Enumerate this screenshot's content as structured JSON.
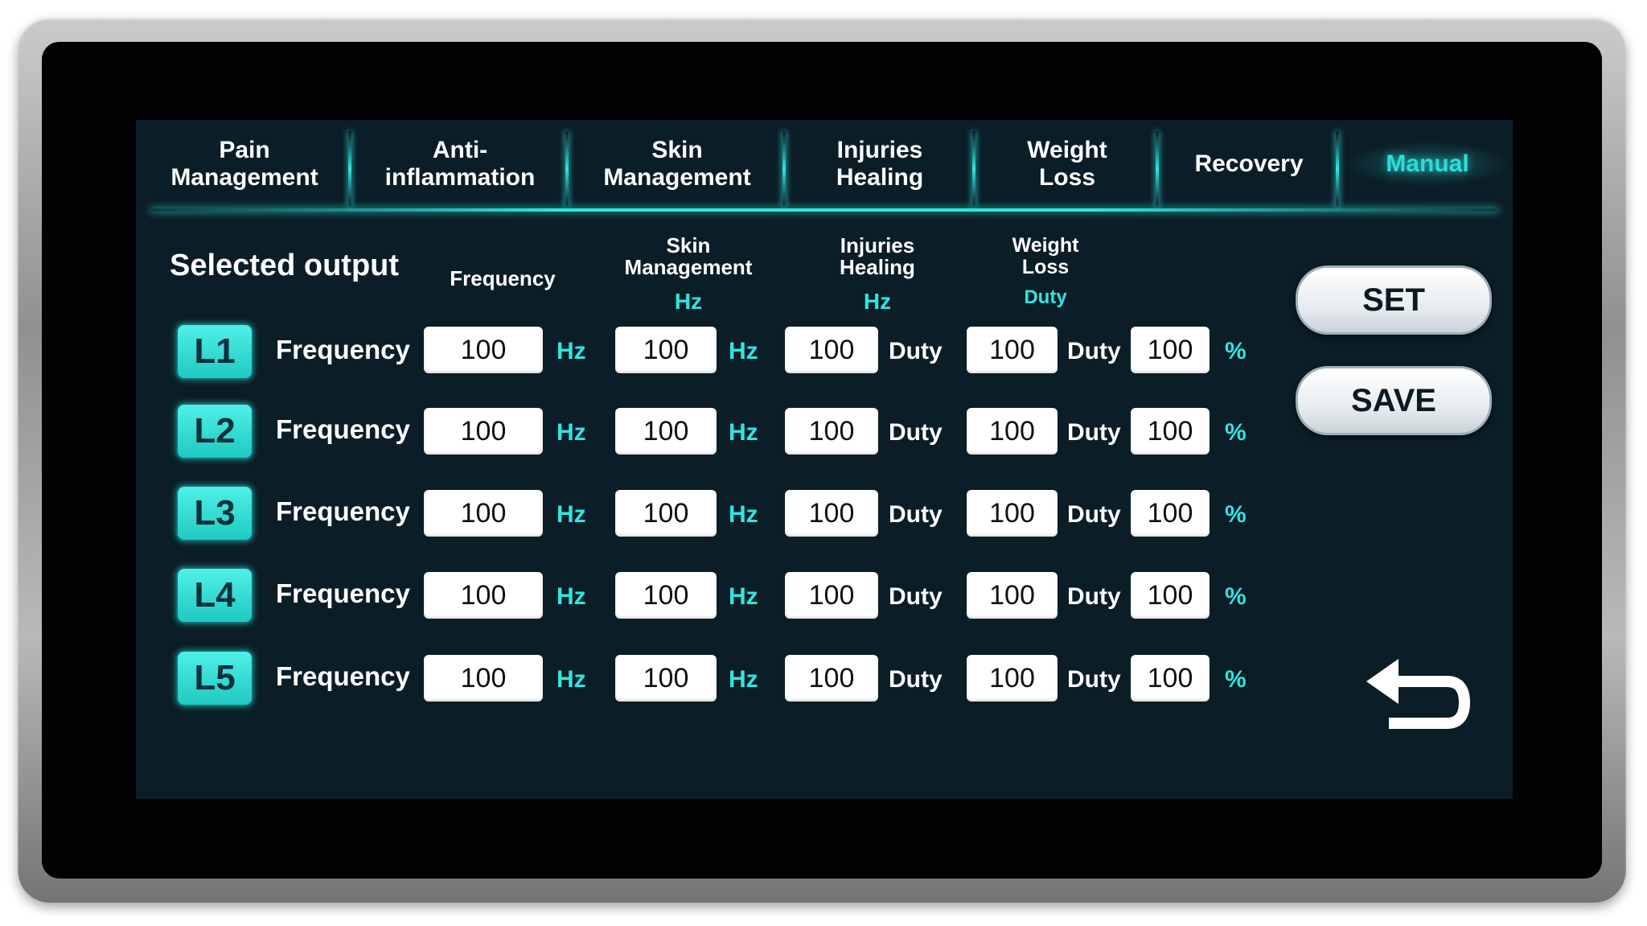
{
  "tabs": [
    {
      "label": "Pain\nManagement",
      "active": false
    },
    {
      "label": "Anti-\ninflammation",
      "active": false
    },
    {
      "label": "Skin\nManagement",
      "active": false
    },
    {
      "label": "Injuries\nHealing",
      "active": false
    },
    {
      "label": "Weight\nLoss",
      "active": false
    },
    {
      "label": "Recovery",
      "active": false
    },
    {
      "label": "Manual",
      "active": true
    }
  ],
  "header": {
    "selected_output": "Selected output",
    "columns": [
      {
        "title": "Frequency",
        "unit": ""
      },
      {
        "title": "Skin\nManagement",
        "unit": "Hz"
      },
      {
        "title": "Injuries\nHealing",
        "unit": "Hz"
      },
      {
        "title": "Weight\nLoss",
        "unit": "Duty"
      }
    ]
  },
  "rows": [
    {
      "id": "L1",
      "label": "Frequency",
      "values": [
        "100",
        "100",
        "100",
        "100",
        "100"
      ],
      "units": [
        "Hz",
        "Hz",
        "Duty",
        "Duty",
        "%"
      ]
    },
    {
      "id": "L2",
      "label": "Frequency",
      "values": [
        "100",
        "100",
        "100",
        "100",
        "100"
      ],
      "units": [
        "Hz",
        "Hz",
        "Duty",
        "Duty",
        "%"
      ]
    },
    {
      "id": "L3",
      "label": "Frequency",
      "values": [
        "100",
        "100",
        "100",
        "100",
        "100"
      ],
      "units": [
        "Hz",
        "Hz",
        "Duty",
        "Duty",
        "%"
      ]
    },
    {
      "id": "L4",
      "label": "Frequency",
      "values": [
        "100",
        "100",
        "100",
        "100",
        "100"
      ],
      "units": [
        "Hz",
        "Hz",
        "Duty",
        "Duty",
        "%"
      ]
    },
    {
      "id": "L5",
      "label": "Frequency",
      "values": [
        "100",
        "100",
        "100",
        "100",
        "100"
      ],
      "units": [
        "Hz",
        "Hz",
        "Duty",
        "Duty",
        "%"
      ]
    }
  ],
  "actions": {
    "set_label": "SET",
    "save_label": "SAVE",
    "back_icon": "return-arrow-icon"
  },
  "colors": {
    "accent": "#2ee6e0",
    "screen_bg": "#0b1d26",
    "field_bg": "#ffffff"
  }
}
